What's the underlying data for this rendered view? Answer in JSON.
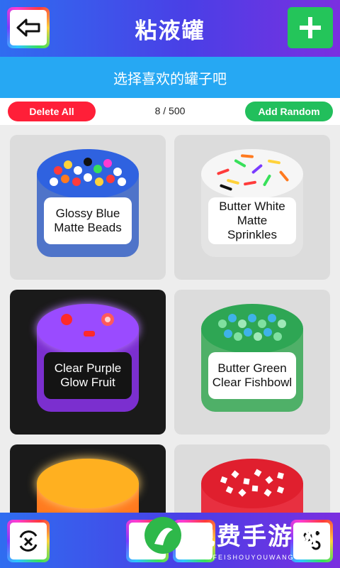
{
  "header": {
    "title": "粘液罐"
  },
  "subheader": {
    "text": "选择喜欢的罐子吧"
  },
  "toolbar": {
    "delete_label": "Delete All",
    "counter": "8 / 500",
    "add_label": "Add Random"
  },
  "jars": [
    {
      "label": "Glossy Blue Matte Beads"
    },
    {
      "label": "Butter White Matte Sprinkles"
    },
    {
      "label": "Clear Purple Glow Fruit"
    },
    {
      "label": "Butter Green Clear Fishbowl"
    },
    {
      "label": ""
    },
    {
      "label": ""
    }
  ],
  "watermark": {
    "text": "免费手游网",
    "subtext": "MIANFEISHOUYOUWANG"
  },
  "colors": {
    "header": "#4a3fe6",
    "subheader": "#26a8f3",
    "delete": "#ff1f38",
    "add": "#22bf5c"
  },
  "icons": [
    "back-arrow-icon",
    "plus-icon",
    "refresh-cross-icon",
    "settings-icon"
  ]
}
